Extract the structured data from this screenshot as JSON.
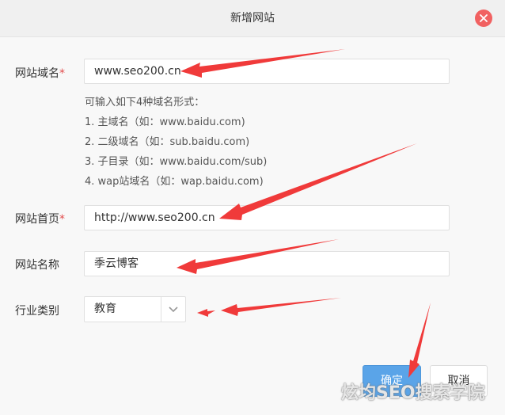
{
  "dialog": {
    "title": "新增网站"
  },
  "form": {
    "domain": {
      "label": "网站域名",
      "required_mark": "*",
      "value": "www.seo200.cn"
    },
    "hint": {
      "intro": "可输入如下4种域名形式：",
      "items": [
        "1. 主域名（如：www.baidu.com)",
        "2. 二级域名（如：sub.baidu.com)",
        "3. 子目录（如：www.baidu.com/sub)",
        "4. wap站域名（如：wap.baidu.com)"
      ]
    },
    "homepage": {
      "label": "网站首页",
      "required_mark": "*",
      "value": "http://www.seo200.cn"
    },
    "site_name": {
      "label": "网站名称",
      "value": "季云博客"
    },
    "industry": {
      "label": "行业类别",
      "selected": "教育"
    }
  },
  "buttons": {
    "confirm": "确定",
    "cancel": "取消"
  },
  "watermark": "炫均SEO搜索学院",
  "colors": {
    "primary": "#5aa4e8",
    "close": "#f16161",
    "arrow": "#f03a3a",
    "required": "#e24b4b"
  },
  "icons": {
    "close": "close-icon",
    "dropdown": "chevron-down-icon"
  }
}
